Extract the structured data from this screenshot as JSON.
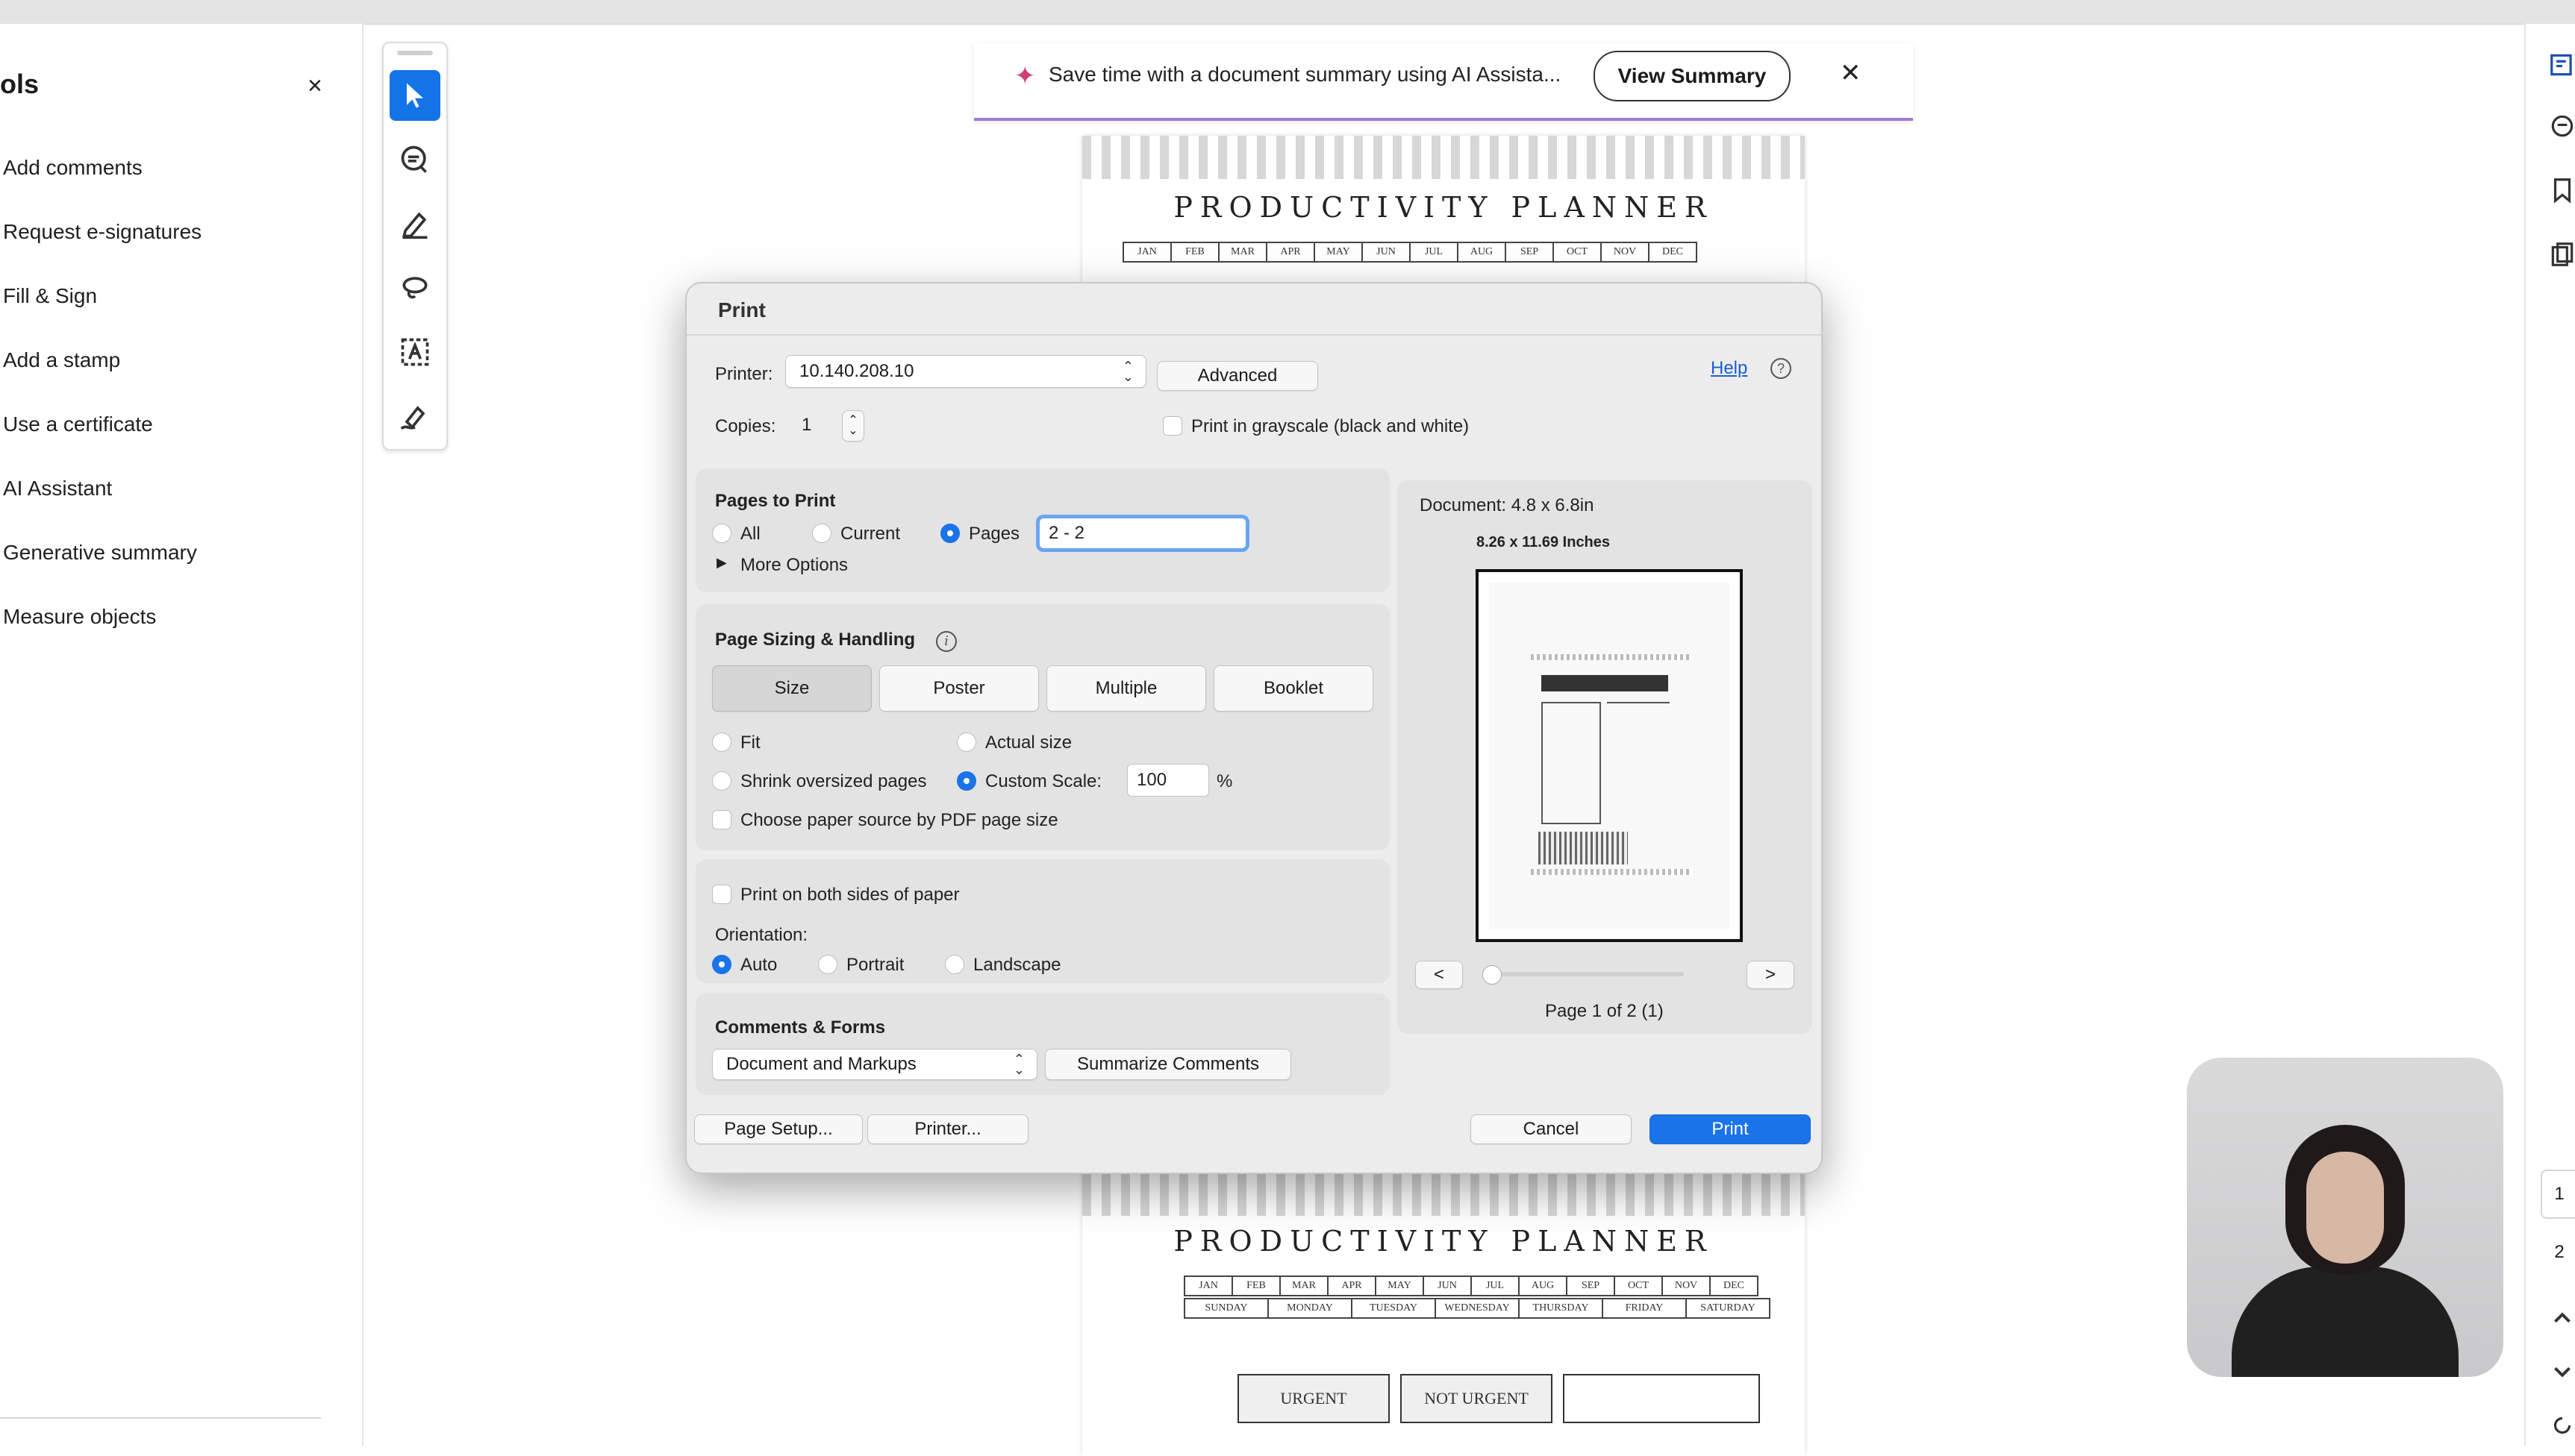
{
  "tools_panel": {
    "title": "ols",
    "close_glyph": "×",
    "items": [
      "Add comments",
      "Request e-signatures",
      "Fill & Sign",
      "Add a stamp",
      "Use a certificate",
      "AI Assistant",
      "Generative summary",
      "Measure objects"
    ]
  },
  "banner": {
    "sparkle": "✦",
    "text": "Save time with a document summary using AI Assista...",
    "button": "View Summary",
    "close_glyph": "✕"
  },
  "document": {
    "planner_title": "PRODUCTIVITY PLANNER",
    "months": [
      "JAN",
      "FEB",
      "MAR",
      "APR",
      "MAY",
      "JUN",
      "JUL",
      "AUG",
      "SEP",
      "OCT",
      "NOV",
      "DEC"
    ],
    "weekdays": [
      "SUNDAY",
      "MONDAY",
      "TUESDAY",
      "WEDNESDAY",
      "THURSDAY",
      "FRIDAY",
      "SATURDAY"
    ],
    "boxes": [
      "URGENT",
      "NOT URGENT"
    ]
  },
  "dialog": {
    "title": "Print",
    "printer_label": "Printer:",
    "printer_value": "10.140.208.10",
    "advanced": "Advanced",
    "help": "Help",
    "copies_label": "Copies:",
    "copies_value": "1",
    "grayscale": "Print in grayscale (black and white)",
    "pages_to_print": {
      "heading": "Pages to Print",
      "all": "All",
      "current": "Current",
      "pages": "Pages",
      "pages_value": "2 - 2",
      "more_options": "More Options"
    },
    "sizing": {
      "heading": "Page Sizing & Handling",
      "tabs": [
        "Size",
        "Poster",
        "Multiple",
        "Booklet"
      ],
      "fit": "Fit",
      "actual_size": "Actual size",
      "shrink": "Shrink oversized pages",
      "custom_scale": "Custom Scale:",
      "scale_value": "100",
      "percent": "%",
      "paper_source": "Choose paper source by PDF page size"
    },
    "both_sides": "Print on both sides of paper",
    "orientation": {
      "label": "Orientation:",
      "auto": "Auto",
      "portrait": "Portrait",
      "landscape": "Landscape"
    },
    "comments_forms": {
      "heading": "Comments & Forms",
      "value": "Document and Markups",
      "summarize": "Summarize Comments"
    },
    "preview": {
      "document_size": "Document: 4.8 x 6.8in",
      "paper_size": "8.26 x 11.69 Inches",
      "prev": "<",
      "next": ">",
      "page_status": "Page 1 of 2 (1)"
    },
    "buttons": {
      "page_setup": "Page Setup...",
      "printer": "Printer...",
      "cancel": "Cancel",
      "print": "Print"
    }
  },
  "page_thumbs": [
    "1",
    "2"
  ],
  "colors": {
    "accent": "#1a73e8",
    "toolbar_active": "#1473e6",
    "banner_underline": "#9a7ad8"
  }
}
